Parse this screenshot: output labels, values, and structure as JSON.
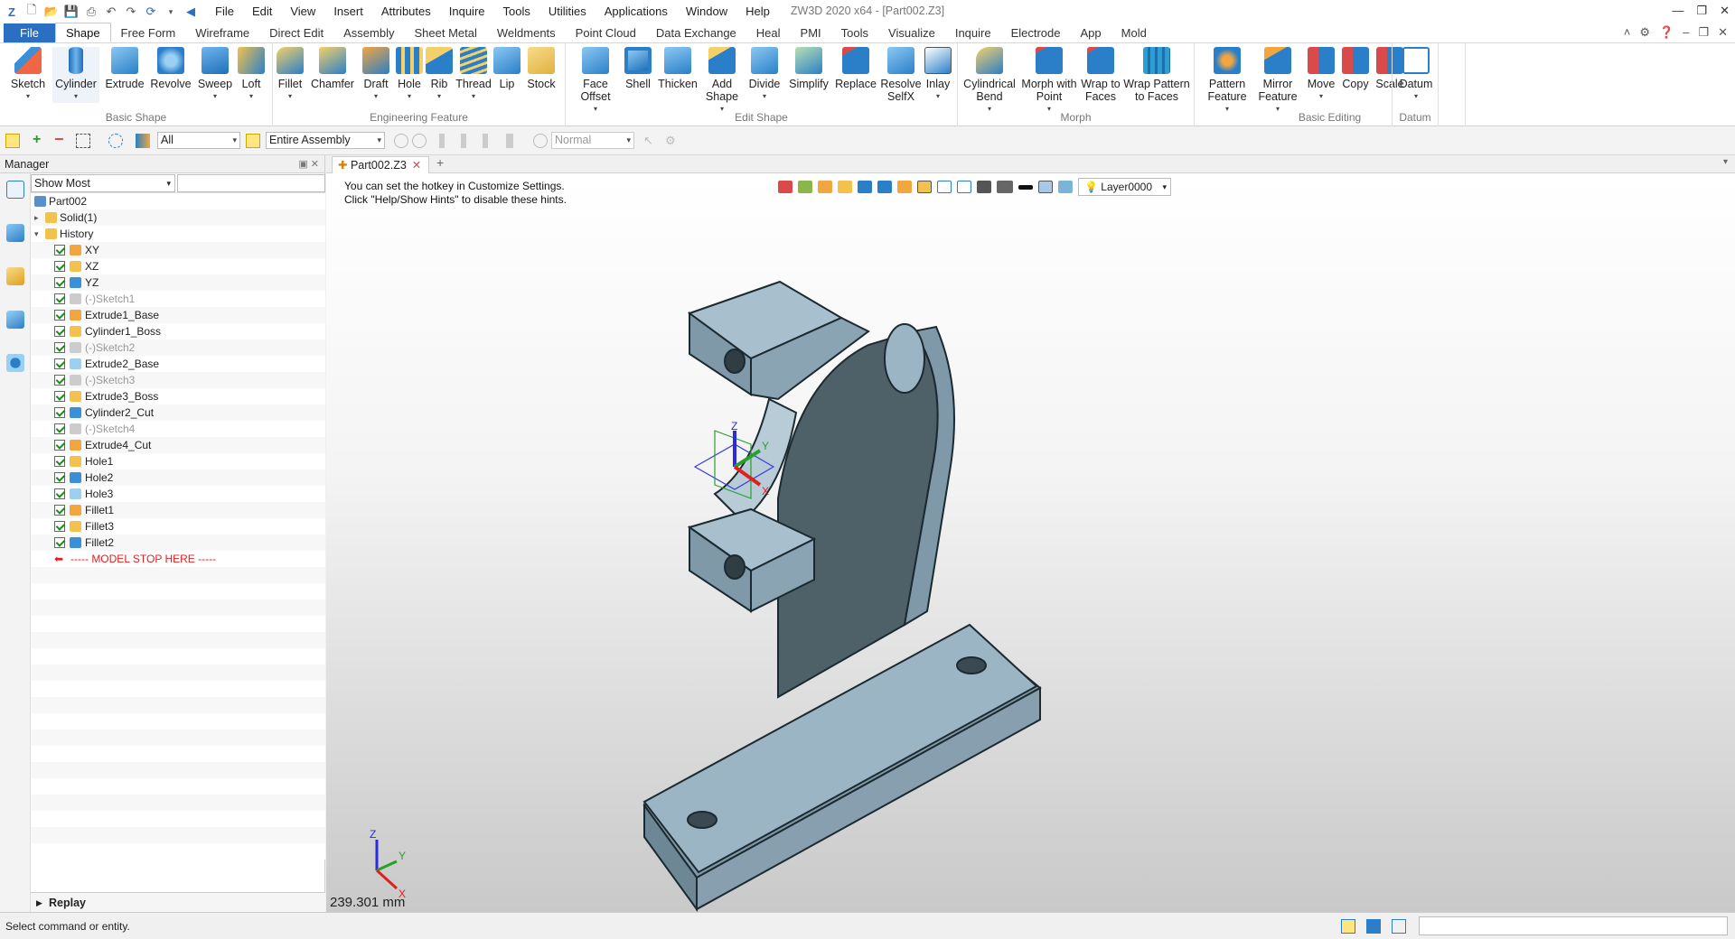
{
  "window": {
    "title": "ZW3D 2020 x64 - [Part002.Z3]"
  },
  "menu": [
    "File",
    "Edit",
    "View",
    "Insert",
    "Attributes",
    "Inquire",
    "Tools",
    "Utilities",
    "Applications",
    "Window",
    "Help"
  ],
  "ribbon_tabs": [
    "File",
    "Shape",
    "Free Form",
    "Wireframe",
    "Direct Edit",
    "Assembly",
    "Sheet Metal",
    "Weldments",
    "Point Cloud",
    "Data Exchange",
    "Heal",
    "PMI",
    "Tools",
    "Visualize",
    "Inquire",
    "Electrode",
    "App",
    "Mold"
  ],
  "active_tab": "Shape",
  "ribbon": {
    "basic_shape": {
      "label": "Basic Shape",
      "buttons": [
        "Sketch",
        "Cylinder",
        "Extrude",
        "Revolve",
        "Sweep",
        "Loft"
      ]
    },
    "engineering_feature": {
      "label": "Engineering Feature",
      "buttons": [
        "Fillet",
        "Chamfer",
        "Draft",
        "Hole",
        "Rib",
        "Thread",
        "Lip",
        "Stock"
      ]
    },
    "edit_shape": {
      "label": "Edit Shape",
      "buttons": [
        "Face Offset",
        "Shell",
        "Thicken",
        "Add Shape",
        "Divide",
        "Simplify",
        "Replace",
        "Resolve SelfX",
        "Inlay"
      ]
    },
    "morph": {
      "label": "Morph",
      "buttons": [
        "Cylindrical Bend",
        "Morph with Point",
        "Wrap to Faces",
        "Wrap Pattern to Faces"
      ]
    },
    "basic_editing": {
      "label": "Basic Editing",
      "buttons": [
        "Pattern Feature",
        "Mirror Feature",
        "Move",
        "Copy",
        "Scale"
      ]
    },
    "datum": {
      "label": "Datum",
      "buttons": [
        "Datum"
      ]
    }
  },
  "toolbar": {
    "filter": "All",
    "scope": "Entire Assembly",
    "mode": "Normal"
  },
  "manager": {
    "title": "Manager",
    "filter": "Show Most",
    "tree": [
      {
        "label": "Part002",
        "level": 0
      },
      {
        "label": "Solid(1)",
        "level": 1
      },
      {
        "label": "History",
        "level": 1
      },
      {
        "label": "XY",
        "level": 2
      },
      {
        "label": "XZ",
        "level": 2
      },
      {
        "label": "YZ",
        "level": 2
      },
      {
        "label": "(-)Sketch1",
        "level": 2,
        "dim": true
      },
      {
        "label": "Extrude1_Base",
        "level": 2
      },
      {
        "label": "Cylinder1_Boss",
        "level": 2
      },
      {
        "label": "(-)Sketch2",
        "level": 2,
        "dim": true
      },
      {
        "label": "Extrude2_Base",
        "level": 2
      },
      {
        "label": "(-)Sketch3",
        "level": 2,
        "dim": true
      },
      {
        "label": "Extrude3_Boss",
        "level": 2
      },
      {
        "label": "Cylinder2_Cut",
        "level": 2
      },
      {
        "label": "(-)Sketch4",
        "level": 2,
        "dim": true
      },
      {
        "label": "Extrude4_Cut",
        "level": 2
      },
      {
        "label": "Hole1",
        "level": 2
      },
      {
        "label": "Hole2",
        "level": 2
      },
      {
        "label": "Hole3",
        "level": 2
      },
      {
        "label": "Fillet1",
        "level": 2
      },
      {
        "label": "Fillet3",
        "level": 2
      },
      {
        "label": "Fillet2",
        "level": 2
      },
      {
        "label": "----- MODEL STOP HERE -----",
        "level": 2,
        "stop": true
      }
    ],
    "replay": "Replay"
  },
  "document": {
    "tab": "Part002.Z3"
  },
  "viewport": {
    "hint_line1": "You can set the hotkey in Customize Settings.",
    "hint_line2": "Click \"Help/Show Hints\" to disable these hints.",
    "layer": "Layer0000",
    "scale": "239.301 mm",
    "triad": {
      "x": "X",
      "y": "Y",
      "z": "Z"
    }
  },
  "status": {
    "text": "Select command or entity."
  },
  "colors": {
    "accent": "#2b6fc2",
    "part_surface": "#8aa4b4",
    "part_dark": "#4e6068",
    "stop_marker": "#e02020"
  }
}
